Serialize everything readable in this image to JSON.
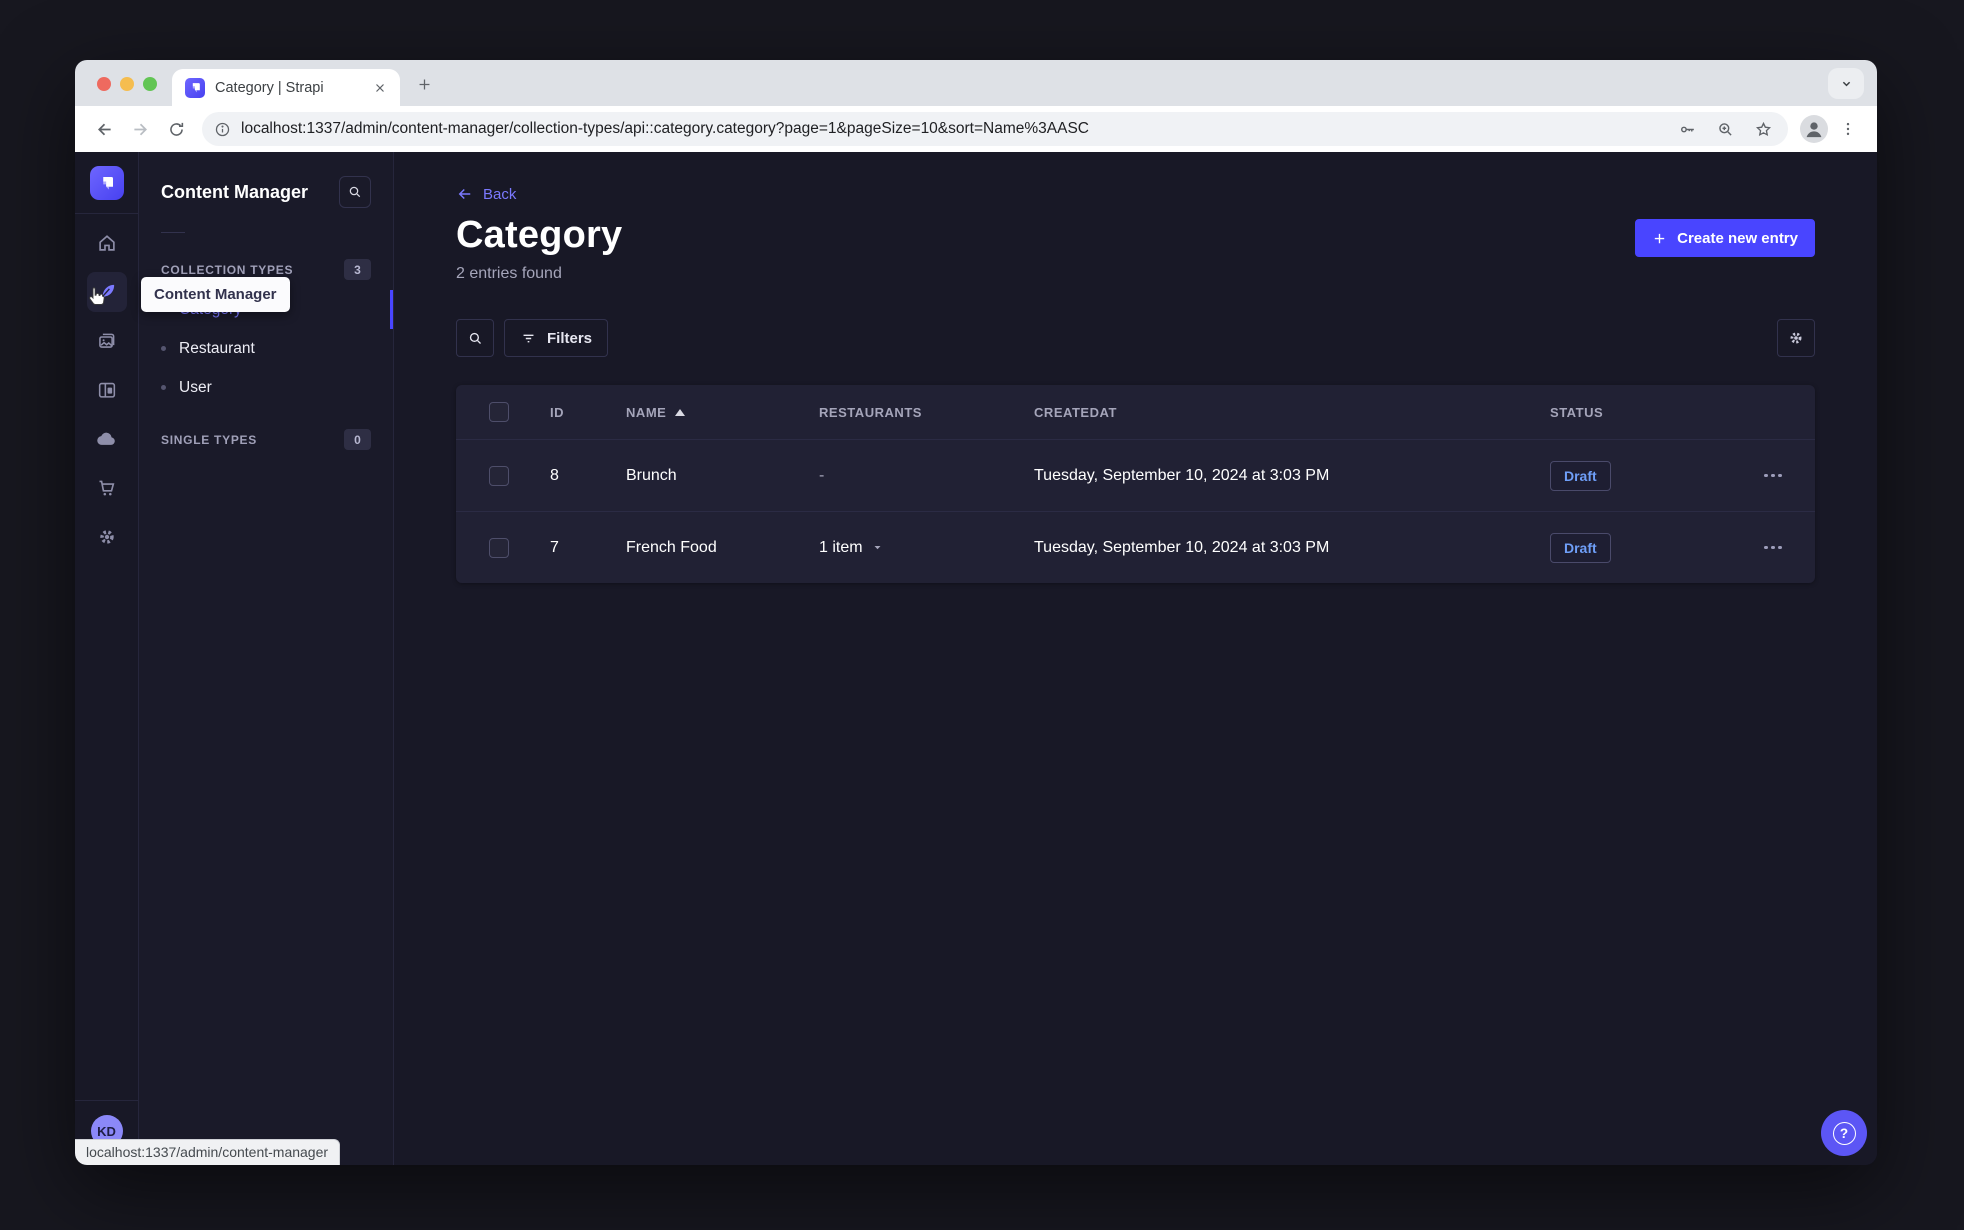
{
  "colors": {
    "brand": "#4945ff",
    "brand-light": "#7b79ff",
    "draft-blue": "#6f9ff8",
    "page-bg": "#181826",
    "card-bg": "#212134"
  },
  "browser": {
    "tab_title": "Category | Strapi",
    "url": "localhost:1337/admin/content-manager/collection-types/api::category.category?page=1&pageSize=10&sort=Name%3AASC",
    "status_bubble": "localhost:1337/admin/content-manager"
  },
  "sidebar": {
    "tooltip": "Content Manager",
    "avatar_initials": "KD",
    "icons": [
      "home",
      "content-manager",
      "media-library",
      "content-type-builder",
      "cloud",
      "marketplace",
      "settings"
    ]
  },
  "subnav": {
    "title": "Content Manager",
    "sections": [
      {
        "label": "COLLECTION TYPES",
        "badge": "3",
        "items": [
          {
            "label": "Category",
            "active": true
          },
          {
            "label": "Restaurant",
            "active": false
          },
          {
            "label": "User",
            "active": false
          }
        ]
      },
      {
        "label": "SINGLE TYPES",
        "badge": "0",
        "items": []
      }
    ]
  },
  "main": {
    "back_label": "Back",
    "title": "Category",
    "subtitle": "2 entries found",
    "create_button": "Create new entry",
    "filters_button": "Filters",
    "help_glyph": "?",
    "table": {
      "columns": [
        "ID",
        "NAME",
        "RESTAURANTS",
        "CREATEDAT",
        "STATUS"
      ],
      "rows": [
        {
          "id": "8",
          "name": "Brunch",
          "restaurants": "-",
          "created_at": "Tuesday, September 10, 2024 at 3:03 PM",
          "status": "Draft"
        },
        {
          "id": "7",
          "name": "French Food",
          "restaurants": "1 item",
          "created_at": "Tuesday, September 10, 2024 at 3:03 PM",
          "status": "Draft"
        }
      ]
    }
  }
}
